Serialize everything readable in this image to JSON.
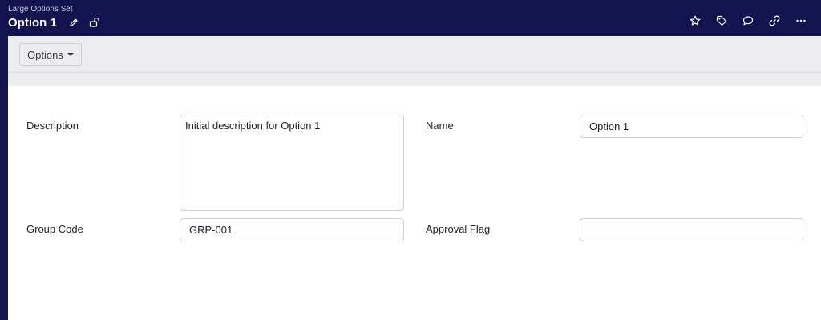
{
  "header": {
    "breadcrumb": "Large Options Set",
    "title": "Option 1",
    "icons": {
      "edit": "pencil-icon",
      "lock": "unlock-icon",
      "actions": [
        "star-icon",
        "tag-icon",
        "comment-icon",
        "link-icon",
        "more-icon"
      ]
    }
  },
  "toolbar": {
    "options_label": "Options"
  },
  "form": {
    "description": {
      "label": "Description",
      "value": "Initial description for Option 1"
    },
    "name": {
      "label": "Name",
      "value": "Option 1"
    },
    "group_code": {
      "label": "Group Code",
      "value": "GRP-001"
    },
    "approval_flag": {
      "label": "Approval Flag",
      "value": ""
    }
  },
  "colors": {
    "header_bg": "#13134f",
    "toolbar_bg": "#ececef",
    "content_bg": "#ffffff",
    "border": "#cfcfd6"
  }
}
